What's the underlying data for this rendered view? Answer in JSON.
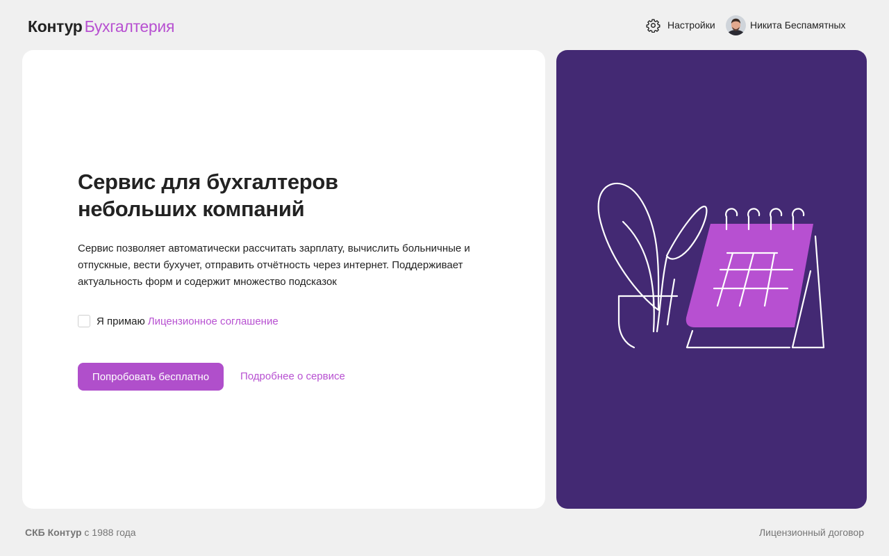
{
  "header": {
    "logo_brand": "Контур",
    "logo_product": "Бухгалтерия",
    "settings_label": "Настройки",
    "user_name": "Никита Беспамятных"
  },
  "main": {
    "headline_lines": [
      "Сервис для бухгалтеров",
      "небольших компаний"
    ],
    "description_lines": [
      "Сервис позволяет автоматически рассчитать зарплату, вычислить больничные и",
      "отпускные, вести бухучет, отправить отчётность через интернет. Поддерживает",
      "актуальность форм и содержит множество подсказок"
    ],
    "agreement_checked": false,
    "agreement_prefix": "Я примаю",
    "agreement_link": "Лицензионное соглашение",
    "try_button_label": "Попробовать бесплатно",
    "more_link_label": "Подробнее о сервисе"
  },
  "promo": {
    "illustration": "plant-and-calendar-illustration"
  },
  "footer": {
    "company": "СКБ Контур",
    "since": "с 1988 года",
    "license_link": "Лицензионный договор"
  },
  "colors": {
    "accent": "#b750d1",
    "button": "#b04fcb",
    "promo_bg": "#432973",
    "page_bg": "#f0f0f0"
  }
}
